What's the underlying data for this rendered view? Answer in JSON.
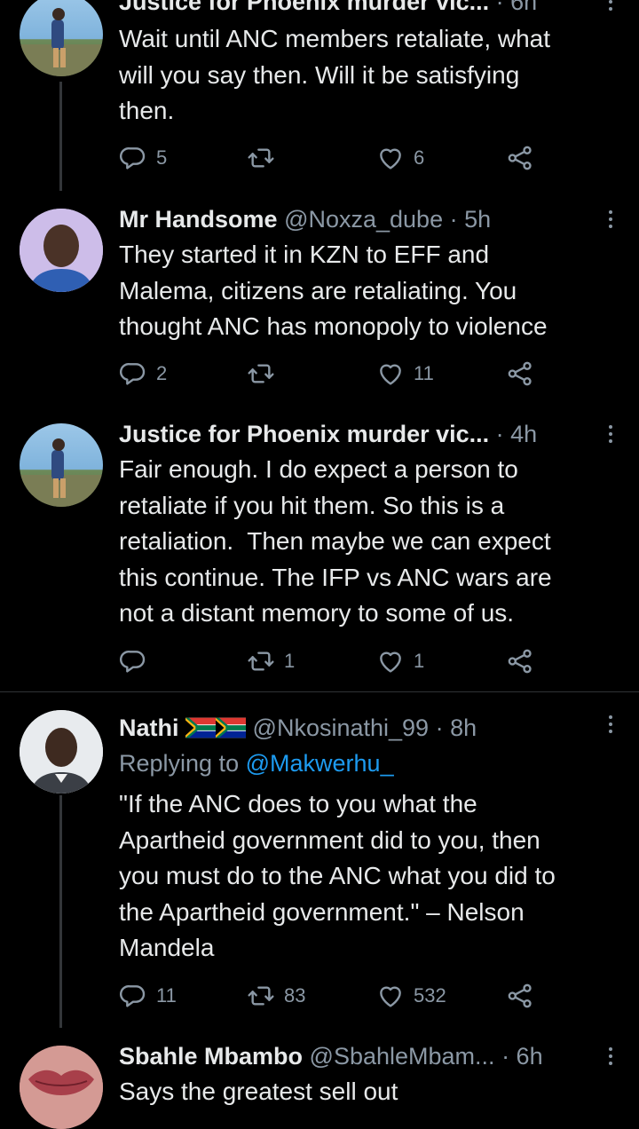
{
  "tweets": [
    {
      "name": "Justice for Phoenix murder vic...",
      "handle": "",
      "time": "· 6h",
      "text": "Wait until ANC members retaliate, what\nwill you say then. Will it be satisfying\nthen.",
      "replies": "5",
      "retweets": "",
      "likes": "6"
    },
    {
      "name": "Mr Handsome",
      "handle": "@Noxza_dube",
      "time": "· 5h",
      "text": "They started it in KZN to EFF and\nMalema, citizens are retaliating. You\nthought ANC has monopoly to violence",
      "replies": "2",
      "retweets": "",
      "likes": "11"
    },
    {
      "name": "Justice for Phoenix murder vic...",
      "handle": "",
      "time": "· 4h",
      "text": "Fair enough. I do expect a person to\nretaliate if you hit them. So this is a\nretaliation.  Then maybe we can expect\nthis continue. The IFP vs ANC wars are\nnot a distant memory to some of us.",
      "replies": "",
      "retweets": "1",
      "likes": "1"
    },
    {
      "name": "Nathi",
      "handle": "@Nkosinathi_99",
      "time": "· 8h",
      "replying_label": "Replying to",
      "replying_handle": "@Makwerhu_",
      "text": "\"If the ANC does to you what the\nApartheid government did to you, then\nyou must do to the ANC what you did to\nthe Apartheid government.\" – Nelson\nMandela",
      "replies": "11",
      "retweets": "83",
      "likes": "532"
    },
    {
      "name": "Sbahle Mbambo",
      "handle": "@SbahleMbam...",
      "time": "· 6h",
      "text": "Says the greatest sell out"
    }
  ],
  "colors": {
    "background": "#000000",
    "text": "#e7e9ea",
    "muted": "#8b98a5",
    "link": "#1d9bf0",
    "divider": "#2f3336"
  },
  "icons": [
    "reply-icon",
    "retweet-icon",
    "like-icon",
    "share-icon",
    "more-icon",
    "south-africa-flag-icon"
  ]
}
